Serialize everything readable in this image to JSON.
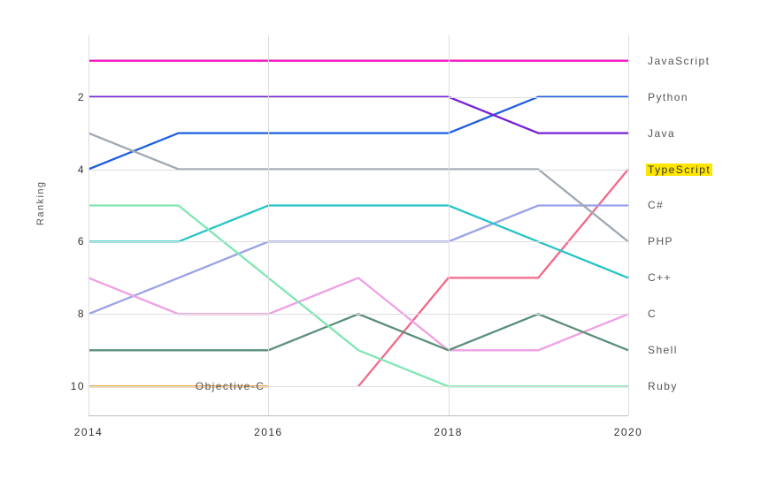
{
  "chart_data": {
    "type": "line",
    "title": "",
    "ylabel": "Ranking",
    "xlabel": "",
    "x": [
      2014,
      2015,
      2016,
      2017,
      2018,
      2019,
      2020
    ],
    "x_ticks": [
      2014,
      2016,
      2018,
      2020
    ],
    "y_ticks": [
      2,
      4,
      6,
      8,
      10
    ],
    "ylim_reversed": true,
    "ylim": [
      10.8,
      0.3
    ],
    "series": [
      {
        "name": "JavaScript",
        "color": "#f217c1",
        "highlight": false,
        "values": [
          1,
          1,
          1,
          1,
          1,
          1,
          1
        ]
      },
      {
        "name": "Python",
        "color": "#1e5fe0",
        "highlight": false,
        "values": [
          4,
          3,
          3,
          3,
          3,
          2,
          2
        ]
      },
      {
        "name": "Java",
        "color": "#7522d6",
        "highlight": false,
        "values": [
          2,
          2,
          2,
          2,
          2,
          3,
          3
        ]
      },
      {
        "name": "TypeScript",
        "color": "#f2688a",
        "highlight": true,
        "values": [
          null,
          null,
          null,
          10,
          7,
          7,
          4
        ]
      },
      {
        "name": "C#",
        "color": "#9aa2e8",
        "highlight": false,
        "values": [
          8,
          7,
          6,
          6,
          6,
          5,
          5
        ]
      },
      {
        "name": "PHP",
        "color": "#a0a8b2",
        "highlight": false,
        "values": [
          3,
          4,
          4,
          4,
          4,
          4,
          6
        ]
      },
      {
        "name": "C++",
        "color": "#27c4c4",
        "highlight": false,
        "values": [
          6,
          6,
          5,
          5,
          5,
          6,
          7
        ]
      },
      {
        "name": "C",
        "color": "#efa0e4",
        "highlight": false,
        "values": [
          7,
          8,
          8,
          7,
          9,
          9,
          8
        ]
      },
      {
        "name": "Shell",
        "color": "#5c8f7a",
        "highlight": false,
        "values": [
          9,
          9,
          9,
          8,
          9,
          8,
          9
        ]
      },
      {
        "name": "Ruby",
        "color": "#7fe6b4",
        "highlight": false,
        "values": [
          5,
          5,
          7,
          9,
          10,
          10,
          10
        ]
      },
      {
        "name": "Objective-C",
        "color": "#f2a23e",
        "highlight": false,
        "values": [
          10,
          10,
          10,
          null,
          null,
          null,
          null
        ],
        "internal_label_at": 2016
      }
    ]
  }
}
